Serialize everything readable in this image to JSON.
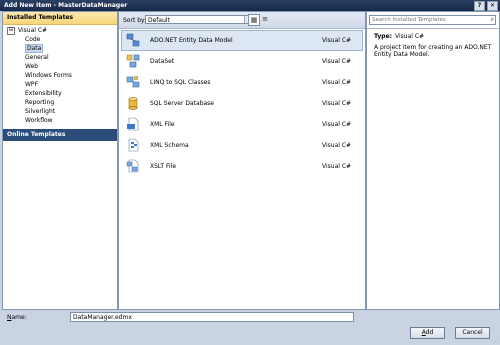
{
  "window": {
    "title": "Add New Item - MasterDataManager",
    "help_glyph": "?",
    "close_glyph": "✕"
  },
  "left": {
    "installed_header": "Installed Templates",
    "root_toggle": "⊟",
    "root": "Visual C#",
    "children": [
      "Code",
      "Data",
      "General",
      "Web",
      "Windows Forms",
      "WPF",
      "Extensibility",
      "Reporting",
      "Silverlight",
      "Workflow"
    ],
    "online_header": "Online Templates"
  },
  "toolbar": {
    "sort_label": "Sort by:",
    "sort_value": "Default",
    "sort_arrow": "▾",
    "list_view_glyph": "≡",
    "grid_view_glyph": "▦"
  },
  "items": [
    {
      "name": "ADO.NET Entity Data Model",
      "lang": "Visual C#",
      "icon": "entity-data-model-icon"
    },
    {
      "name": "DataSet",
      "lang": "Visual C#",
      "icon": "dataset-icon"
    },
    {
      "name": "LINQ to SQL Classes",
      "lang": "Visual C#",
      "icon": "linq-to-sql-icon"
    },
    {
      "name": "SQL Server Database",
      "lang": "Visual C#",
      "icon": "database-icon"
    },
    {
      "name": "XML File",
      "lang": "Visual C#",
      "icon": "xml-file-icon"
    },
    {
      "name": "XML Schema",
      "lang": "Visual C#",
      "icon": "xml-schema-icon"
    },
    {
      "name": "XSLT File",
      "lang": "Visual C#",
      "icon": "xslt-file-icon"
    }
  ],
  "right": {
    "search_placeholder": "Search Installed Templates",
    "search_glyph": "⌕",
    "type_label": "Type:",
    "type_value": "Visual C#",
    "description": "A project item for creating an ADO.NET Entity Data Model."
  },
  "bottom": {
    "name_label_first": "N",
    "name_label_rest": "ame:",
    "name_value": "DataManager.edmx",
    "add_first": "A",
    "add_rest": "dd",
    "cancel_label": "Cancel",
    "grip_glyph": "⋰"
  }
}
